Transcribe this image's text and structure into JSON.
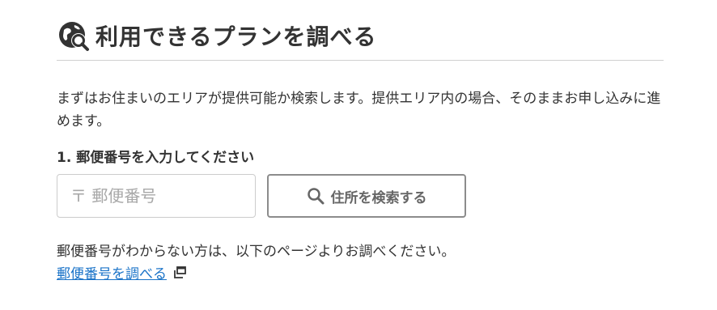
{
  "header": {
    "title": "利用できるプランを調べる",
    "icon": "globe-search-icon"
  },
  "intro": {
    "text": "まずはお住まいのエリアが提供可能か検索します。提供エリア内の場合、そのままお申し込みに進めます。"
  },
  "step": {
    "label": "1. 郵便番号を入力してください"
  },
  "postal_input": {
    "placeholder": "〒 郵便番号",
    "value": ""
  },
  "search_button": {
    "label": "住所を検索する",
    "icon": "search-icon"
  },
  "help": {
    "note": "郵便番号がわからない方は、以下のページよりお調べください。",
    "link_label": "郵便番号を調べる",
    "link_icon": "external-window-icon"
  },
  "colors": {
    "text": "#333333",
    "link": "#1a73c8",
    "button_border": "#8c8c8c",
    "input_border": "#cccccc",
    "divider": "#d0d0d0"
  }
}
